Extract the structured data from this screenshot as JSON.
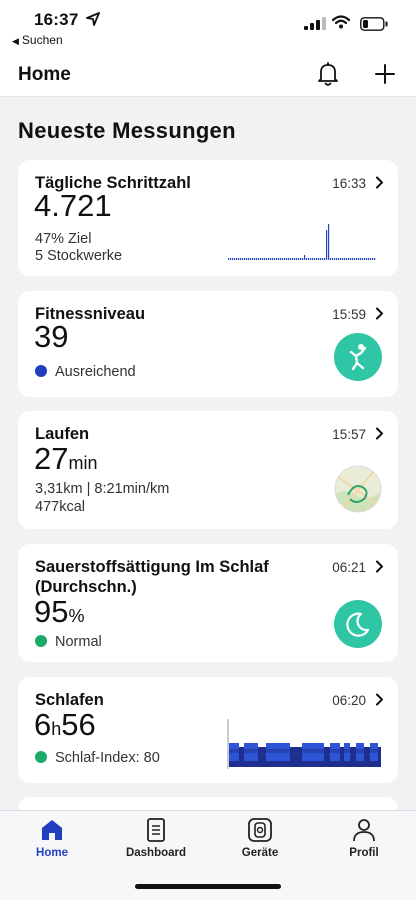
{
  "status_bar": {
    "time": "16:37",
    "back_label": "Suchen"
  },
  "nav": {
    "title": "Home"
  },
  "section_title": "Neueste Messungen",
  "cards": {
    "steps": {
      "title": "Tägliche Schrittzahl",
      "time": "16:33",
      "value": "4.721",
      "goal": "47% Ziel",
      "floors": "5 Stockwerke"
    },
    "fitness": {
      "title": "Fitnessniveau",
      "time": "15:59",
      "value": "39",
      "status": "Ausreichend",
      "status_color": "#1f3fbf"
    },
    "running": {
      "title": "Laufen",
      "time": "15:57",
      "value": "27",
      "unit": "min",
      "line1": "3,31km | 8:21min/km",
      "line2": "477kcal"
    },
    "oxygen": {
      "title_line1": "Sauerstoffsättigung Im Schlaf",
      "title_line2": "(Durchschn.)",
      "time": "06:21",
      "value": "95",
      "unit": "%",
      "status": "Normal",
      "status_color": "#1aaa6b"
    },
    "sleep": {
      "title": "Schlafen",
      "time": "06:20",
      "value_h": "6",
      "unit_h": "h",
      "value_m": "56",
      "index": "Schlaf-Index: 80",
      "index_color": "#1aaa6b"
    }
  },
  "tabs": [
    {
      "label": "Home",
      "icon": "home-icon",
      "active": true
    },
    {
      "label": "Dashboard",
      "icon": "dashboard-icon",
      "active": false
    },
    {
      "label": "Geräte",
      "icon": "watch-icon",
      "active": false
    },
    {
      "label": "Profil",
      "icon": "profile-icon",
      "active": false
    }
  ],
  "colors": {
    "accent": "#1f3fbf",
    "teal": "#2ec6a4"
  }
}
